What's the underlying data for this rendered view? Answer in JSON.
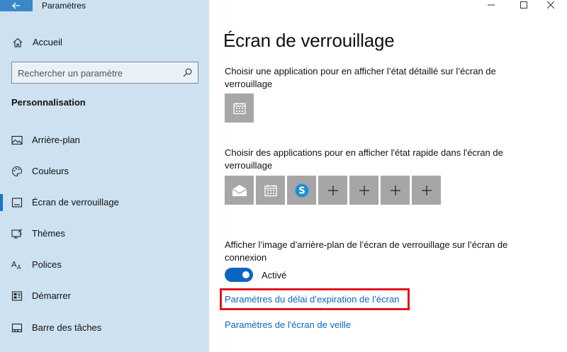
{
  "window": {
    "title": "Paramètres"
  },
  "sidebar": {
    "home_label": "Accueil",
    "search_placeholder": "Rechercher un paramètre",
    "section_title": "Personnalisation",
    "items": [
      {
        "label": "Arrière-plan",
        "icon": "picture-icon"
      },
      {
        "label": "Couleurs",
        "icon": "palette-icon"
      },
      {
        "label": "Écran de verrouillage",
        "icon": "lock-screen-icon",
        "active": true
      },
      {
        "label": "Thèmes",
        "icon": "themes-icon"
      },
      {
        "label": "Polices",
        "icon": "fonts-icon"
      },
      {
        "label": "Démarrer",
        "icon": "start-icon"
      },
      {
        "label": "Barre des tâches",
        "icon": "taskbar-icon"
      }
    ]
  },
  "main": {
    "title": "Écran de verrouillage",
    "detailed_status_desc": "Choisir une application pour en afficher l’état détaillé sur l’écran de verrouillage",
    "detailed_status_app": "calendar-icon",
    "quick_status_desc": "Choisir des applications pour en afficher l'état rapide dans l'écran de verrouillage",
    "quick_status_apps": [
      "mail-icon",
      "calendar-icon",
      "skype-icon",
      "plus-icon",
      "plus-icon",
      "plus-icon",
      "plus-icon"
    ],
    "background_desc": "Afficher l’image d’arrière-plan de l’écran de verrouillage sur l’écran de connexion",
    "toggle_state": "Activé",
    "link_timeout": "Paramètres du délai d’expiration de l’écran",
    "link_screensaver": "Paramètres de l'écran de veille"
  },
  "colors": {
    "accent": "#0b66c2",
    "sidebar_bg": "#cde1f0",
    "highlight": "#e0161e"
  }
}
